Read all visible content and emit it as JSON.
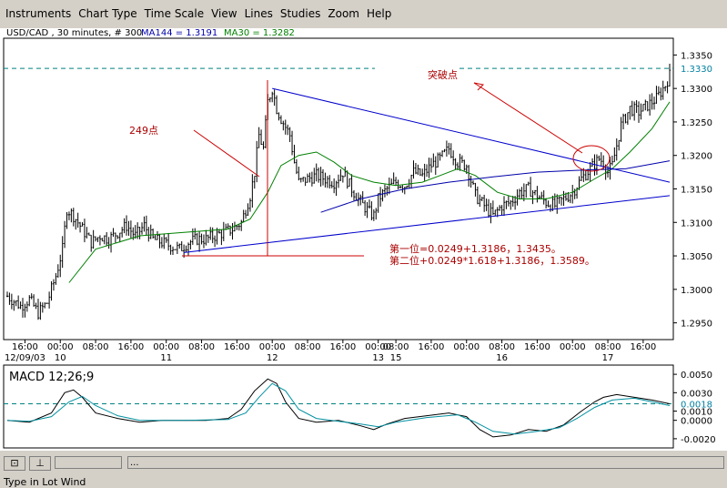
{
  "menu": [
    "Instruments",
    "Chart Type",
    "Time Scale",
    "View",
    "Lines",
    "Studies",
    "Zoom",
    "Help"
  ],
  "price_header": {
    "symbol": "USD/CAD , 30 minutes, # 300",
    "ma144": "MA144 = 1.3191",
    "ma30": "MA30 = 1.3282"
  },
  "macd_header": "MACD 12;26;9",
  "annotations": {
    "points": "249点",
    "breakout": "突破点",
    "target1": "第一位=0.0249+1.3186，1.3435。",
    "target2": "第二位+0.0249*1.618+1.3186，1.3589。"
  },
  "toolbar": {
    "field_text": "..."
  },
  "status_text": "Type in Lot Wind",
  "colors": {
    "candle": "#000000",
    "ma30": "#008000",
    "ma144": "#0000aa",
    "trendline": "#0000cc",
    "annotation": "#aa0000",
    "dashed": "#008080",
    "macd": "#000000",
    "signal": "#0090a0",
    "price_marker": "#0080a0"
  },
  "chart_data": [
    {
      "type": "candlestick",
      "title": "USD/CAD , 30 minutes, # 300",
      "y_ticks": [
        1.295,
        1.3,
        1.305,
        1.31,
        1.315,
        1.32,
        1.325,
        1.33,
        1.335
      ],
      "y_tick_labels": [
        "1.2950",
        "1.3000",
        "1.3050",
        "1.3100",
        "1.3150",
        "1.3200",
        "1.3250",
        "1.3300",
        "1.3350"
      ],
      "ylim": [
        1.2925,
        1.3375
      ],
      "xlim": [
        0,
        300
      ],
      "x_tick_positions": [
        8,
        24,
        40,
        56,
        72,
        88,
        104,
        120,
        136,
        152,
        168,
        176,
        192,
        208,
        224,
        240,
        256,
        272,
        288,
        304
      ],
      "x_tick_labels": [
        "16:00",
        "00:00",
        "08:00",
        "16:00",
        "00:00",
        "08:00",
        "16:00",
        "00:00",
        "08:00",
        "16:00",
        "00:00",
        "08:00",
        "16:00",
        "00:00",
        "08:00",
        "16:00",
        "00:00",
        "08:00",
        "16:00",
        "00:00"
      ],
      "date_labels": [
        {
          "x": 8,
          "label": "12/09/03"
        },
        {
          "x": 24,
          "label": "10"
        },
        {
          "x": 72,
          "label": "11"
        },
        {
          "x": 120,
          "label": "12"
        },
        {
          "x": 168,
          "label": "13"
        },
        {
          "x": 176,
          "label": "15"
        },
        {
          "x": 224,
          "label": "16"
        },
        {
          "x": 272,
          "label": "17"
        }
      ],
      "current_price": 1.333,
      "price_path": [
        [
          0,
          1.299
        ],
        [
          6,
          1.2975
        ],
        [
          10,
          1.2985
        ],
        [
          14,
          1.2965
        ],
        [
          18,
          1.298
        ],
        [
          22,
          1.302
        ],
        [
          25,
          1.306
        ],
        [
          27,
          1.312
        ],
        [
          30,
          1.311
        ],
        [
          34,
          1.309
        ],
        [
          38,
          1.307
        ],
        [
          42,
          1.308
        ],
        [
          46,
          1.3075
        ],
        [
          50,
          1.3085
        ],
        [
          54,
          1.3095
        ],
        [
          58,
          1.308
        ],
        [
          62,
          1.3095
        ],
        [
          66,
          1.3075
        ],
        [
          70,
          1.307
        ],
        [
          74,
          1.3065
        ],
        [
          78,
          1.306
        ],
        [
          82,
          1.307
        ],
        [
          86,
          1.3075
        ],
        [
          90,
          1.3075
        ],
        [
          94,
          1.308
        ],
        [
          98,
          1.3085
        ],
        [
          102,
          1.309
        ],
        [
          106,
          1.31
        ],
        [
          110,
          1.314
        ],
        [
          112,
          1.3175
        ],
        [
          114,
          1.323
        ],
        [
          116,
          1.321
        ],
        [
          118,
          1.328
        ],
        [
          120,
          1.33
        ],
        [
          122,
          1.327
        ],
        [
          124,
          1.3255
        ],
        [
          128,
          1.323
        ],
        [
          130,
          1.319
        ],
        [
          132,
          1.316
        ],
        [
          136,
          1.3165
        ],
        [
          140,
          1.317
        ],
        [
          144,
          1.3165
        ],
        [
          148,
          1.316
        ],
        [
          152,
          1.3175
        ],
        [
          156,
          1.315
        ],
        [
          160,
          1.313
        ],
        [
          164,
          1.3115
        ],
        [
          166,
          1.311
        ],
        [
          168,
          1.3135
        ],
        [
          172,
          1.315
        ],
        [
          176,
          1.316
        ],
        [
          180,
          1.3155
        ],
        [
          184,
          1.3175
        ],
        [
          188,
          1.317
        ],
        [
          192,
          1.3185
        ],
        [
          196,
          1.3195
        ],
        [
          200,
          1.321
        ],
        [
          204,
          1.319
        ],
        [
          208,
          1.3185
        ],
        [
          212,
          1.314
        ],
        [
          216,
          1.3125
        ],
        [
          220,
          1.311
        ],
        [
          224,
          1.3125
        ],
        [
          228,
          1.313
        ],
        [
          232,
          1.3145
        ],
        [
          236,
          1.315
        ],
        [
          240,
          1.314
        ],
        [
          244,
          1.313
        ],
        [
          248,
          1.3125
        ],
        [
          252,
          1.3135
        ],
        [
          256,
          1.3145
        ],
        [
          260,
          1.3165
        ],
        [
          264,
          1.318
        ],
        [
          268,
          1.3195
        ],
        [
          270,
          1.319
        ],
        [
          272,
          1.3175
        ],
        [
          274,
          1.3185
        ],
        [
          276,
          1.3215
        ],
        [
          278,
          1.3245
        ],
        [
          282,
          1.327
        ],
        [
          286,
          1.3265
        ],
        [
          290,
          1.3275
        ],
        [
          294,
          1.3285
        ],
        [
          296,
          1.3295
        ],
        [
          298,
          1.3305
        ],
        [
          300,
          1.332
        ]
      ],
      "series": [
        {
          "name": "MA30",
          "points": [
            [
              28,
              1.301
            ],
            [
              40,
              1.306
            ],
            [
              60,
              1.308
            ],
            [
              80,
              1.3085
            ],
            [
              100,
              1.309
            ],
            [
              110,
              1.3105
            ],
            [
              118,
              1.3145
            ],
            [
              124,
              1.3185
            ],
            [
              132,
              1.32
            ],
            [
              140,
              1.3205
            ],
            [
              148,
              1.319
            ],
            [
              156,
              1.317
            ],
            [
              166,
              1.316
            ],
            [
              176,
              1.3155
            ],
            [
              188,
              1.316
            ],
            [
              196,
              1.317
            ],
            [
              204,
              1.318
            ],
            [
              212,
              1.317
            ],
            [
              222,
              1.3145
            ],
            [
              232,
              1.3135
            ],
            [
              244,
              1.3135
            ],
            [
              256,
              1.3145
            ],
            [
              266,
              1.3165
            ],
            [
              274,
              1.318
            ],
            [
              282,
              1.3205
            ],
            [
              292,
              1.324
            ],
            [
              300,
              1.328
            ]
          ]
        },
        {
          "name": "MA144",
          "points": [
            [
              142,
              1.3115
            ],
            [
              160,
              1.3135
            ],
            [
              180,
              1.315
            ],
            [
              200,
              1.316
            ],
            [
              220,
              1.3168
            ],
            [
              240,
              1.3175
            ],
            [
              260,
              1.3178
            ],
            [
              280,
              1.318
            ],
            [
              300,
              1.3192
            ]
          ]
        }
      ],
      "trendlines": [
        {
          "name": "upper",
          "from": [
            120,
            1.33
          ],
          "to": [
            300,
            1.316
          ]
        },
        {
          "name": "lower",
          "from": [
            80,
            1.3055
          ],
          "to": [
            300,
            1.314
          ]
        }
      ]
    },
    {
      "type": "line",
      "title": "MACD 12;26;9",
      "y_ticks": [
        -0.002,
        0.0,
        0.001,
        0.003,
        0.005
      ],
      "y_tick_labels": [
        "-0.0020",
        "0.0000",
        "0.0010",
        "0.0030",
        "0.0050"
      ],
      "ylim": [
        -0.003,
        0.006
      ],
      "current_value": 0.0018,
      "current_value_label": "0.0018",
      "series": [
        {
          "name": "MACD",
          "points": [
            [
              0,
              0.0
            ],
            [
              10,
              -0.0002
            ],
            [
              20,
              0.0008
            ],
            [
              26,
              0.003
            ],
            [
              30,
              0.0033
            ],
            [
              34,
              0.0025
            ],
            [
              40,
              0.0008
            ],
            [
              50,
              0.0002
            ],
            [
              60,
              -0.0002
            ],
            [
              70,
              0.0
            ],
            [
              80,
              0.0
            ],
            [
              90,
              0.0
            ],
            [
              100,
              0.0002
            ],
            [
              106,
              0.0012
            ],
            [
              112,
              0.0032
            ],
            [
              118,
              0.0045
            ],
            [
              122,
              0.004
            ],
            [
              126,
              0.002
            ],
            [
              132,
              0.0002
            ],
            [
              140,
              -0.0002
            ],
            [
              150,
              0.0
            ],
            [
              160,
              -0.0006
            ],
            [
              166,
              -0.001
            ],
            [
              172,
              -0.0004
            ],
            [
              180,
              0.0002
            ],
            [
              190,
              0.0005
            ],
            [
              200,
              0.0008
            ],
            [
              208,
              0.0004
            ],
            [
              214,
              -0.001
            ],
            [
              220,
              -0.0018
            ],
            [
              228,
              -0.0016
            ],
            [
              236,
              -0.001
            ],
            [
              244,
              -0.0012
            ],
            [
              252,
              -0.0005
            ],
            [
              260,
              0.001
            ],
            [
              266,
              0.002
            ],
            [
              270,
              0.0025
            ],
            [
              276,
              0.0028
            ],
            [
              284,
              0.0025
            ],
            [
              292,
              0.0022
            ],
            [
              300,
              0.0018
            ]
          ]
        },
        {
          "name": "Signal",
          "points": [
            [
              0,
              0.0
            ],
            [
              10,
              -0.0001
            ],
            [
              20,
              0.0004
            ],
            [
              28,
              0.002
            ],
            [
              34,
              0.0026
            ],
            [
              40,
              0.0016
            ],
            [
              50,
              0.0005
            ],
            [
              60,
              0.0
            ],
            [
              80,
              0.0
            ],
            [
              100,
              0.0001
            ],
            [
              108,
              0.0008
            ],
            [
              114,
              0.0025
            ],
            [
              120,
              0.004
            ],
            [
              126,
              0.0032
            ],
            [
              132,
              0.0012
            ],
            [
              140,
              0.0002
            ],
            [
              150,
              -0.0001
            ],
            [
              160,
              -0.0004
            ],
            [
              168,
              -0.0007
            ],
            [
              176,
              -0.0002
            ],
            [
              190,
              0.0003
            ],
            [
              204,
              0.0006
            ],
            [
              212,
              -0.0002
            ],
            [
              220,
              -0.0012
            ],
            [
              230,
              -0.0015
            ],
            [
              240,
              -0.0012
            ],
            [
              250,
              -0.0008
            ],
            [
              258,
              0.0002
            ],
            [
              266,
              0.0014
            ],
            [
              274,
              0.0022
            ],
            [
              284,
              0.0024
            ],
            [
              292,
              0.002
            ],
            [
              300,
              0.0016
            ]
          ]
        }
      ]
    }
  ]
}
